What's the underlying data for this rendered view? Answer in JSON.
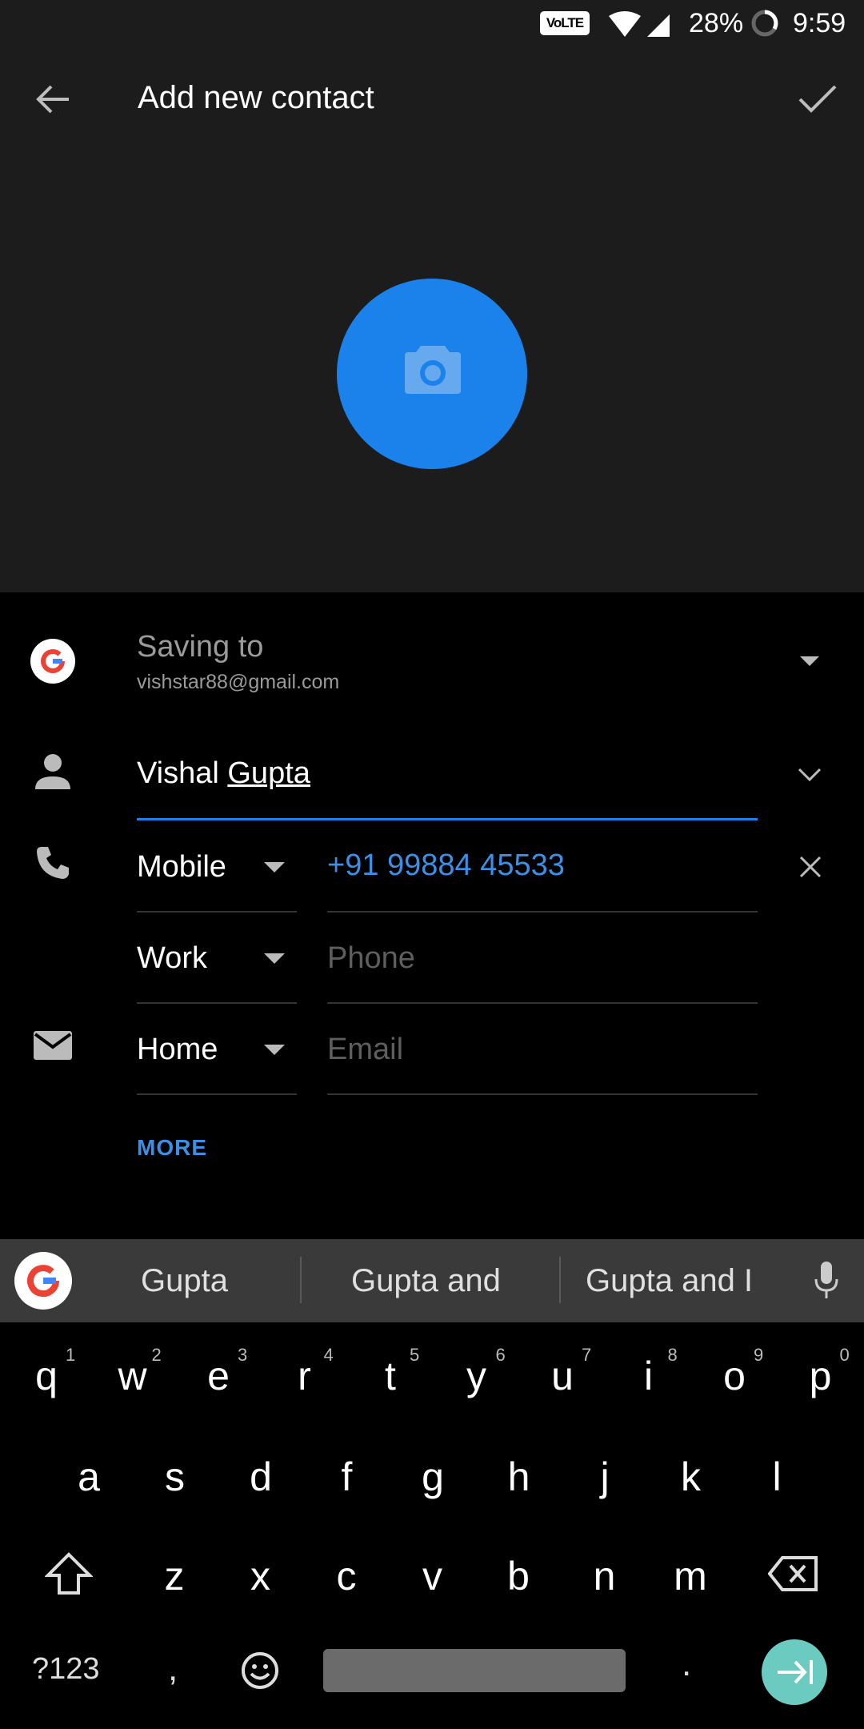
{
  "status_bar": {
    "volte": "VoLTE",
    "battery": "28%",
    "time": "9:59"
  },
  "header": {
    "title": "Add new contact",
    "back_icon": "arrow-back-icon",
    "confirm_icon": "checkmark-icon"
  },
  "photo": {
    "icon": "camera-icon",
    "color": "#1a82ea"
  },
  "account": {
    "label": "Saving to",
    "email": "vishstar88@gmail.com"
  },
  "name": {
    "first": "Vishal",
    "last": "Gupta"
  },
  "phone_rows": [
    {
      "type": "Mobile",
      "value": "+91 99884 45533",
      "placeholder": ""
    },
    {
      "type": "Work",
      "value": "",
      "placeholder": "Phone"
    }
  ],
  "email_row": {
    "type": "Home",
    "value": "",
    "placeholder": "Email"
  },
  "more_label": "MORE",
  "keyboard": {
    "suggestions": [
      "Gupta",
      "Gupta and",
      "Gupta and I"
    ],
    "row1": [
      "q",
      "w",
      "e",
      "r",
      "t",
      "y",
      "u",
      "i",
      "o",
      "p"
    ],
    "row1_hints": [
      "1",
      "2",
      "3",
      "4",
      "5",
      "6",
      "7",
      "8",
      "9",
      "0"
    ],
    "row2": [
      "a",
      "s",
      "d",
      "f",
      "g",
      "h",
      "j",
      "k",
      "l"
    ],
    "row3": [
      "z",
      "x",
      "c",
      "v",
      "b",
      "n",
      "m"
    ],
    "symbols_key": "?123",
    "comma_key": ",",
    "period_key": "."
  },
  "colors": {
    "accent": "#1a82ea",
    "enter_key": "#6bcbc0",
    "header_bg": "#1c1c1c"
  }
}
